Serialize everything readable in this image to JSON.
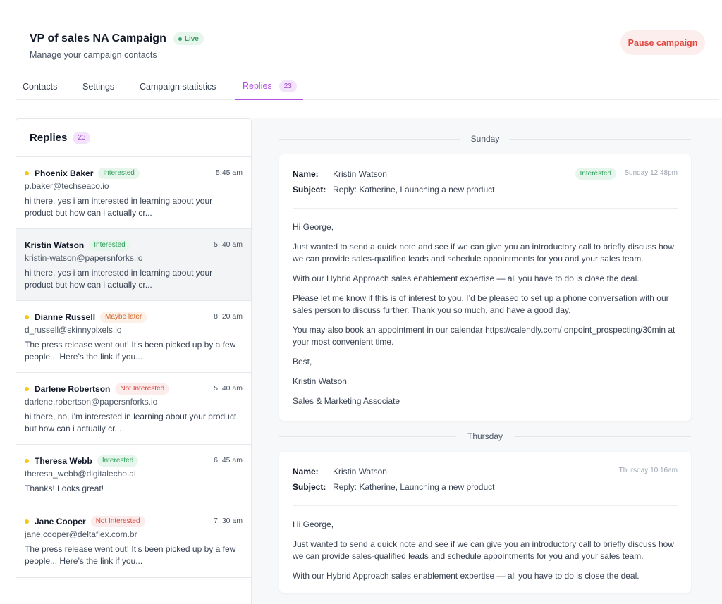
{
  "header": {
    "title": "VP of sales NA Campaign",
    "live_label": "Live",
    "subtitle": "Manage your campaign contacts",
    "pause_label": "Pause campaign"
  },
  "tabs": [
    {
      "label": "Contacts"
    },
    {
      "label": "Settings"
    },
    {
      "label": "Campaign statistics"
    },
    {
      "label": "Replies",
      "count": "23",
      "active": true
    }
  ],
  "replies_panel": {
    "title": "Replies",
    "count": "23",
    "items": [
      {
        "name": "Phoenix Baker",
        "status": "Interested",
        "time": "5:45 am",
        "email": "p.baker@techseaco.io",
        "snippet": "hi there, yes i am interested in learning about your product but how can i actually cr...",
        "unread": true
      },
      {
        "name": "Kristin Watson",
        "status": "Interested",
        "time": "5: 40 am",
        "email": "kristin-watson@papersnforks.io",
        "snippet": "hi there, yes i am interested in learning about your product but how can i actually cr...",
        "unread": false,
        "selected": true
      },
      {
        "name": "Dianne Russell",
        "status": "Maybe later",
        "time": "8: 20 am",
        "email": "d_russell@skinnypixels.io",
        "snippet": "The press release went out! It’s been picked up by a few people... Here’s the link if you...",
        "unread": true
      },
      {
        "name": "Darlene Robertson",
        "status": "Not Interested",
        "time": "5: 40 am",
        "email": "darlene.robertson@papersnforks.io",
        "snippet": "hi there, no, i’m interested in learning about your product but how can i actually cr...",
        "unread": true
      },
      {
        "name": "Theresa Webb",
        "status": "Interested",
        "time": "6: 45 am",
        "email": "theresa_webb@digitalecho.ai",
        "snippet": "Thanks! Looks great!",
        "unread": true
      },
      {
        "name": "Jane Cooper",
        "status": "Not Interested",
        "time": "7: 30 am",
        "email": "jane.cooper@deltaflex.com.br",
        "snippet": "The press release went out! It’s been picked up by a few people... Here’s the link if you...",
        "unread": true
      }
    ]
  },
  "thread": {
    "days": [
      {
        "label": "Sunday"
      },
      {
        "label": "Thursday"
      }
    ],
    "messages": [
      {
        "name_label": "Name:",
        "name": "Kristin Watson",
        "subject_label": "Subject:",
        "subject": "Reply: Katherine, Launching a new product",
        "status": "Interested",
        "time": "Sunday 12:48pm",
        "body": [
          "Hi George,",
          "Just wanted to send a quick note and see if we can give you an introductory call to briefly discuss how we can provide sales-qualified leads and schedule appointments for you and your sales team.",
          "With our Hybrid Approach sales enablement expertise — all you have to do is close the deal.",
          "Please let me know if this is of interest to you. I’d be pleased to set up a phone conversation with our sales person to discuss further. Thank you so much, and have a good day.",
          "You may also book an appointment in our calendar https://calendly.com/ onpoint_prospecting/30min at your most convenient time.",
          "Best,",
          "Kristin Watson",
          "Sales & Marketing Associate"
        ]
      },
      {
        "name_label": "Name:",
        "name": "Kristin Watson",
        "subject_label": "Subject:",
        "subject": "Reply: Katherine, Launching a new product",
        "time": "Thursday 10:16am",
        "body": [
          "Hi George,",
          "Just wanted to send a quick note and see if we can give you an introductory call to briefly discuss how we can provide sales-qualified leads and schedule appointments for you and your sales team.",
          "With our Hybrid Approach sales enablement expertise — all you have to do is close the deal."
        ]
      }
    ]
  }
}
